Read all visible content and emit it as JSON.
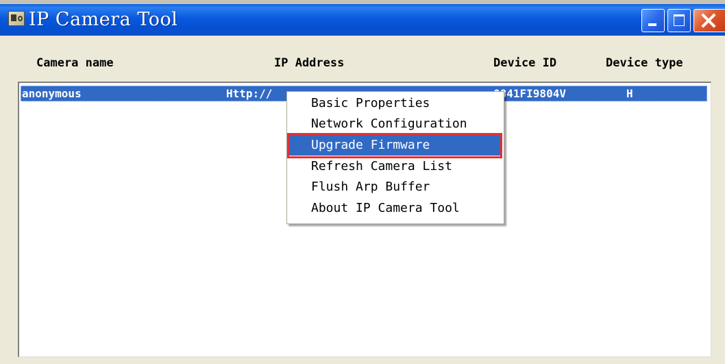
{
  "window": {
    "title": "IP Camera Tool",
    "icon": "camera-app-icon",
    "controls": [
      "minimize-icon",
      "maximize-icon",
      "close-icon"
    ]
  },
  "columns": {
    "camera_name": "Camera name",
    "ip_address": "IP Address",
    "device_id": "Device ID",
    "device_type": "Device type"
  },
  "rows": [
    {
      "camera_name": "anonymous",
      "ip_address": "Http://",
      "device_id": "0841FI9804V",
      "device_type": "H"
    }
  ],
  "context_menu": {
    "items": [
      "Basic Properties",
      "Network Configuration",
      "Upgrade Firmware",
      "Refresh Camera List",
      "Flush Arp Buffer",
      "About IP Camera Tool"
    ],
    "highlighted": "Upgrade Firmware"
  },
  "colors": {
    "titlebar": "#0a53d6",
    "selection": "#316ac5",
    "annotation_box": "#e53030",
    "window_bg": "#ece9d8"
  }
}
